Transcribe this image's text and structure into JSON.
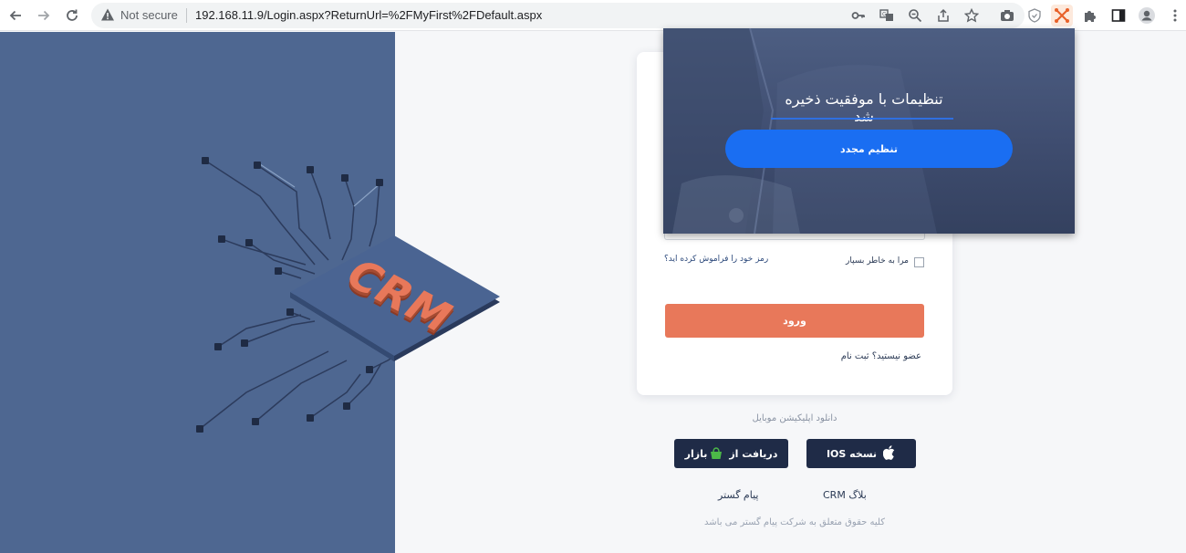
{
  "browser": {
    "security_label": "Not secure",
    "url": "192.168.11.9/Login.aspx?ReturnUrl=%2FMyFirst%2FDefault.aspx",
    "nav_icons": [
      "back-arrow-icon",
      "forward-arrow-icon",
      "reload-icon"
    ],
    "omnibox_icons": [
      "key-icon",
      "translate-icon",
      "zoom-icon",
      "share-icon",
      "star-icon"
    ],
    "extension_icons": [
      "camera-icon",
      "shield-icon",
      "network-extension-icon",
      "puzzle-icon",
      "side-panel-icon",
      "profile-icon",
      "menu-icon"
    ]
  },
  "illustration": {
    "chip_label": "CRM",
    "background_color": "#4e6791",
    "chip_text_color": "#e8785a"
  },
  "login": {
    "remember_label": "مرا به خاطر بسپار",
    "forgot_link": "رمز خود را فراموش کرده اید؟",
    "submit_label": "ورود",
    "register_link": "عضو نیستید؟ ثبت نام",
    "submit_color": "#e8785a"
  },
  "mobile": {
    "download_label": "دانلود اپلیکیشن موبایل",
    "ios_label": "نسخه IOS",
    "bazaar_label": "دریافت از",
    "bazaar_logo_text": "بازار",
    "button_color": "#1f2b47"
  },
  "footer": {
    "blog_link": "بلاگ CRM",
    "company_link": "پیام گستر",
    "copyright": "کلیه حقوق متعلق به شرکت پیام گستر می باشد"
  },
  "popup": {
    "message": "تنظیمات با موفقیت ذخیره شد",
    "reset_label": "تنظیم مجدد",
    "button_color": "#1a6ef2"
  }
}
